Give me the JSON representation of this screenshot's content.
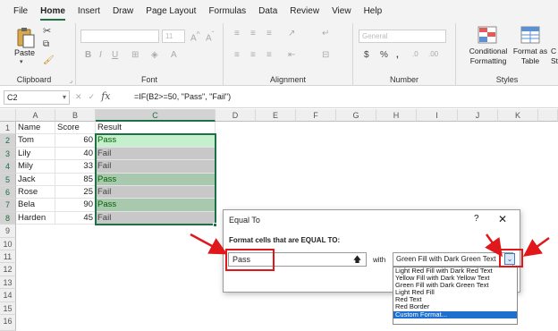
{
  "menu": [
    "File",
    "Home",
    "Insert",
    "Draw",
    "Page Layout",
    "Formulas",
    "Data",
    "Review",
    "View",
    "Help"
  ],
  "ribbon": {
    "paste_label": "Paste",
    "clipboard_label": "Clipboard",
    "font_label": "Font",
    "alignment_label": "Alignment",
    "number_label": "Number",
    "styles_label": "Styles",
    "font_size": "11",
    "number_format": "General",
    "conditional_line1": "Conditional",
    "conditional_line2": "Formatting",
    "format_table_line1": "Format as",
    "format_table_line2": "Table",
    "cell_styles_line1": "C",
    "cell_styles_line2": "St"
  },
  "formula_bar": {
    "name_box": "C2",
    "fx": "fx",
    "formula": "=IF(B2>=50, \"Pass\", \"Fail\")"
  },
  "columns": [
    "A",
    "B",
    "C",
    "D",
    "E",
    "F",
    "G",
    "H",
    "I",
    "J",
    "K"
  ],
  "rows": [
    "1",
    "2",
    "3",
    "4",
    "5",
    "6",
    "7",
    "8",
    "9",
    "10",
    "11",
    "12",
    "13",
    "14",
    "15",
    "16"
  ],
  "table": {
    "headers": [
      "Name",
      "Score",
      "Result"
    ],
    "data": [
      {
        "name": "Tom",
        "score": "60",
        "result": "Pass"
      },
      {
        "name": "Lily",
        "score": "40",
        "result": "Fail"
      },
      {
        "name": "Mily",
        "score": "33",
        "result": "Fail"
      },
      {
        "name": "Jack",
        "score": "85",
        "result": "Pass"
      },
      {
        "name": "Rose",
        "score": "25",
        "result": "Fail"
      },
      {
        "name": "Bela",
        "score": "90",
        "result": "Pass"
      },
      {
        "name": "Harden",
        "score": "45",
        "result": "Fail"
      }
    ]
  },
  "dialog": {
    "title": "Equal To",
    "help": "?",
    "close": "✕",
    "label": "Format cells that are EQUAL TO:",
    "value": "Pass",
    "with_label": "with",
    "format_value": "Green Fill with Dark Green Text",
    "options": [
      "Light Red Fill with Dark Red Text",
      "Yellow Fill with Dark Yellow Text",
      "Green Fill with Dark Green Text",
      "Light Red Fill",
      "Red Text",
      "Red Border",
      "Custom Format..."
    ],
    "highlighted_option": "Custom Format..."
  },
  "colors": {
    "accent": "#1e7145",
    "annotation": "#e0171b",
    "pass_fill": "#c6efce",
    "pass_text": "#006100",
    "highlight": "#1f6fcf"
  }
}
